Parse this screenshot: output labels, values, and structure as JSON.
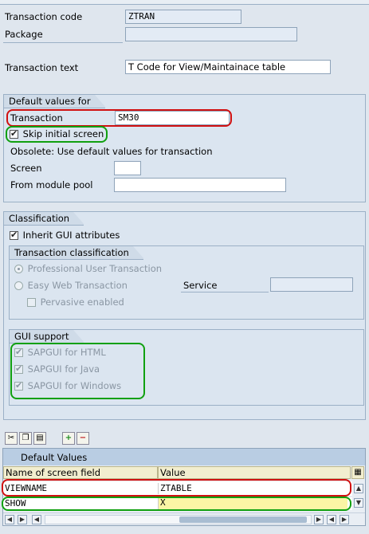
{
  "header": {
    "transaction_code_label": "Transaction code",
    "transaction_code_value": "ZTRAN",
    "package_label": "Package",
    "package_value": "",
    "transaction_text_label": "Transaction text",
    "transaction_text_value": "T Code for View/Maintainace table"
  },
  "default_values": {
    "title": "Default values for",
    "transaction_label": "Transaction",
    "transaction_value": "SM30",
    "skip_initial_screen_label": "Skip initial screen",
    "skip_initial_screen_checked": true,
    "obsolete_text": "Obsolete: Use default values for transaction",
    "screen_label": "Screen",
    "screen_value": "",
    "module_pool_label": "From module pool",
    "module_pool_value": ""
  },
  "classification": {
    "title": "Classification",
    "inherit_gui_label": "Inherit GUI attributes",
    "inherit_gui_checked": true,
    "transaction_classification": {
      "title": "Transaction classification",
      "professional_label": "Professional User Transaction",
      "easy_web_label": "Easy Web Transaction",
      "service_label": "Service",
      "service_value": "",
      "pervasive_label": "Pervasive enabled"
    },
    "gui_support": {
      "title": "GUI support",
      "html_label": "SAPGUI for HTML",
      "java_label": "SAPGUI for Java",
      "windows_label": "SAPGUI for Windows"
    }
  },
  "table": {
    "title": "Default Values",
    "columns": [
      "Name of screen field",
      "Value"
    ],
    "rows": [
      {
        "name": "VIEWNAME",
        "value": "ZTABLE"
      },
      {
        "name": "SHOW",
        "value": "X"
      }
    ]
  },
  "icons": {
    "cut": "scissors-icon",
    "copy": "copy-icon",
    "paste": "paste-icon",
    "insert_row": "insert-row-icon",
    "delete_row": "delete-row-icon",
    "table_settings": "table-settings-icon"
  },
  "colors": {
    "highlight_red": "#d01010",
    "highlight_green": "#10a010",
    "panel_background": "#dfe6ee"
  }
}
